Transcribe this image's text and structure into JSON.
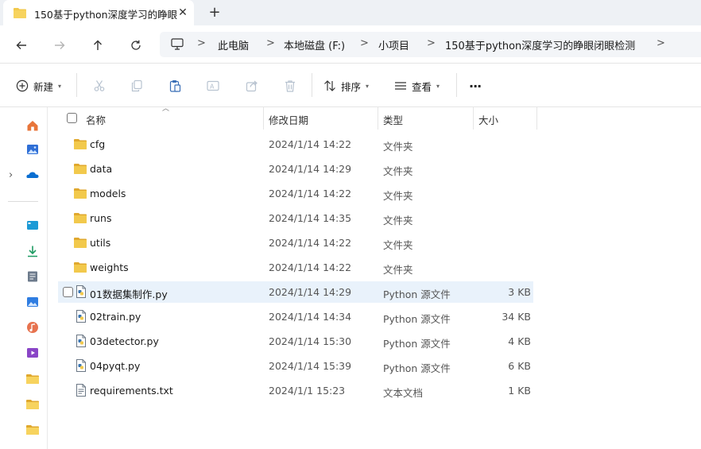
{
  "window": {
    "tab_title": "150基于python深度学习的睁眼",
    "close_glyph": "✕",
    "new_tab_glyph": "+"
  },
  "address": {
    "crumbs": [
      "此电脑",
      "本地磁盘 (F:)",
      "小项目",
      "150基于python深度学习的睁眼闭眼检测"
    ],
    "sep": ">"
  },
  "toolbar": {
    "new_label": "新建",
    "sort_label": "排序",
    "view_label": "查看",
    "more_label": "···"
  },
  "columns": {
    "name": "名称",
    "date": "修改日期",
    "type": "类型",
    "size": "大小"
  },
  "files": [
    {
      "name": "cfg",
      "date": "2024/1/14 14:22",
      "type": "文件夹",
      "size": "",
      "kind": "folder"
    },
    {
      "name": "data",
      "date": "2024/1/14 14:29",
      "type": "文件夹",
      "size": "",
      "kind": "folder"
    },
    {
      "name": "models",
      "date": "2024/1/14 14:22",
      "type": "文件夹",
      "size": "",
      "kind": "folder"
    },
    {
      "name": "runs",
      "date": "2024/1/14 14:35",
      "type": "文件夹",
      "size": "",
      "kind": "folder"
    },
    {
      "name": "utils",
      "date": "2024/1/14 14:22",
      "type": "文件夹",
      "size": "",
      "kind": "folder"
    },
    {
      "name": "weights",
      "date": "2024/1/14 14:22",
      "type": "文件夹",
      "size": "",
      "kind": "folder"
    },
    {
      "name": "01数据集制作.py",
      "date": "2024/1/14 14:29",
      "type": "Python 源文件",
      "size": "3 KB",
      "kind": "py"
    },
    {
      "name": "02train.py",
      "date": "2024/1/14 14:34",
      "type": "Python 源文件",
      "size": "34 KB",
      "kind": "py"
    },
    {
      "name": "03detector.py",
      "date": "2024/1/14 15:30",
      "type": "Python 源文件",
      "size": "4 KB",
      "kind": "py"
    },
    {
      "name": "04pyqt.py",
      "date": "2024/1/14 15:39",
      "type": "Python 源文件",
      "size": "6 KB",
      "kind": "py"
    },
    {
      "name": "requirements.txt",
      "date": "2024/1/1 15:23",
      "type": "文本文档",
      "size": "1 KB",
      "kind": "txt"
    }
  ],
  "colors": {
    "folder": "#f2c94c",
    "folder_dark": "#e0a82e",
    "selected_row": "#e9f2fb",
    "onedrive": "#0a6ed1"
  }
}
